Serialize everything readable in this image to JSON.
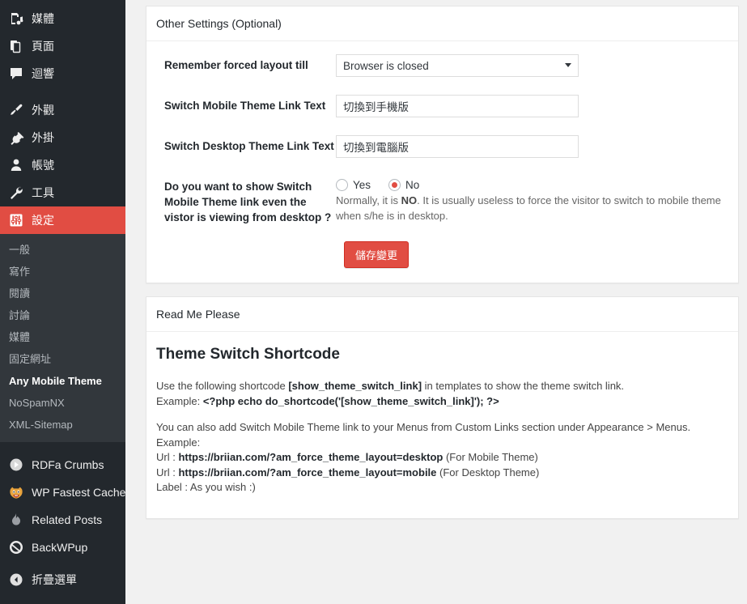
{
  "sidebar": {
    "top_items": [
      {
        "label": "媒體",
        "icon": "media-icon"
      },
      {
        "label": "頁面",
        "icon": "pages-icon"
      },
      {
        "label": "迴響",
        "icon": "comments-icon"
      }
    ],
    "mid_items": [
      {
        "label": "外觀",
        "icon": "appearance-brush-icon"
      },
      {
        "label": "外掛",
        "icon": "plugins-plug-icon"
      },
      {
        "label": "帳號",
        "icon": "users-icon"
      },
      {
        "label": "工具",
        "icon": "tools-wrench-icon"
      },
      {
        "label": "設定",
        "icon": "settings-sliders-icon",
        "active": true
      }
    ],
    "submenu": [
      {
        "label": "一般"
      },
      {
        "label": "寫作"
      },
      {
        "label": "閱讀"
      },
      {
        "label": "討論"
      },
      {
        "label": "媒體"
      },
      {
        "label": "固定網址"
      },
      {
        "label": "Any Mobile Theme",
        "current": true
      },
      {
        "label": "NoSpamNX"
      },
      {
        "label": "XML-Sitemap"
      }
    ],
    "plugin_items": [
      {
        "label": "RDFa Crumbs",
        "icon": "play-circle-icon"
      },
      {
        "label": "WP Fastest Cache",
        "icon": "tiger-icon"
      },
      {
        "label": "Related Posts",
        "icon": "flame-icon"
      },
      {
        "label": "BackWPup",
        "icon": "backwpup-icon"
      }
    ],
    "collapse": {
      "label": "折疊選單",
      "icon": "collapse-arrow-icon"
    },
    "colors": {
      "bg": "#23282d",
      "submenu_bg": "#32373c",
      "active": "#e14d43"
    }
  },
  "settings_panel": {
    "title": "Other Settings (Optional)",
    "remember_layout": {
      "label": "Remember forced layout till",
      "value": "Browser is closed",
      "options": [
        "Browser is closed"
      ]
    },
    "mobile_link_text": {
      "label": "Switch Mobile Theme Link Text",
      "value": "切換到手機版",
      "placeholder": ""
    },
    "desktop_link_text": {
      "label": "Switch Desktop Theme Link Text",
      "value": "切換到電腦版",
      "placeholder": ""
    },
    "show_switch_question": {
      "label": "Do you want to show Switch Mobile Theme link even the vistor is viewing from desktop ?",
      "yes_label": "Yes",
      "no_label": "No",
      "selected": "No",
      "description_1": "Normally, it is ",
      "description_bold": "NO",
      "description_2": ". It is usually useless to force the visitor to switch to mobile theme when s/he is in desktop."
    },
    "save_button": "儲存變更"
  },
  "readme_panel": {
    "title": "Read Me Please",
    "heading": "Theme Switch Shortcode",
    "para1_a": "Use the following shortcode ",
    "para1_code": "[show_theme_switch_link]",
    "para1_b": " in templates to show the theme switch link.",
    "para1_line2_a": "Example: ",
    "para1_line2_code": "<?php echo do_shortcode('[show_theme_switch_link]'); ?>",
    "para2_line1": "You can also add Switch Mobile Theme link to your Menus from Custom Links section under Appearance > Menus.",
    "para2_line2": "Example:",
    "url_prefix_1": "Url : ",
    "url_1": "https://briian.com/?am_force_theme_layout=desktop",
    "url_1_suffix": " (For Mobile Theme)",
    "url_prefix_2": "Url : ",
    "url_2": "https://briian.com/?am_force_theme_layout=mobile",
    "url_2_suffix": " (For Desktop Theme)",
    "label_line": "Label : As you wish :)"
  }
}
